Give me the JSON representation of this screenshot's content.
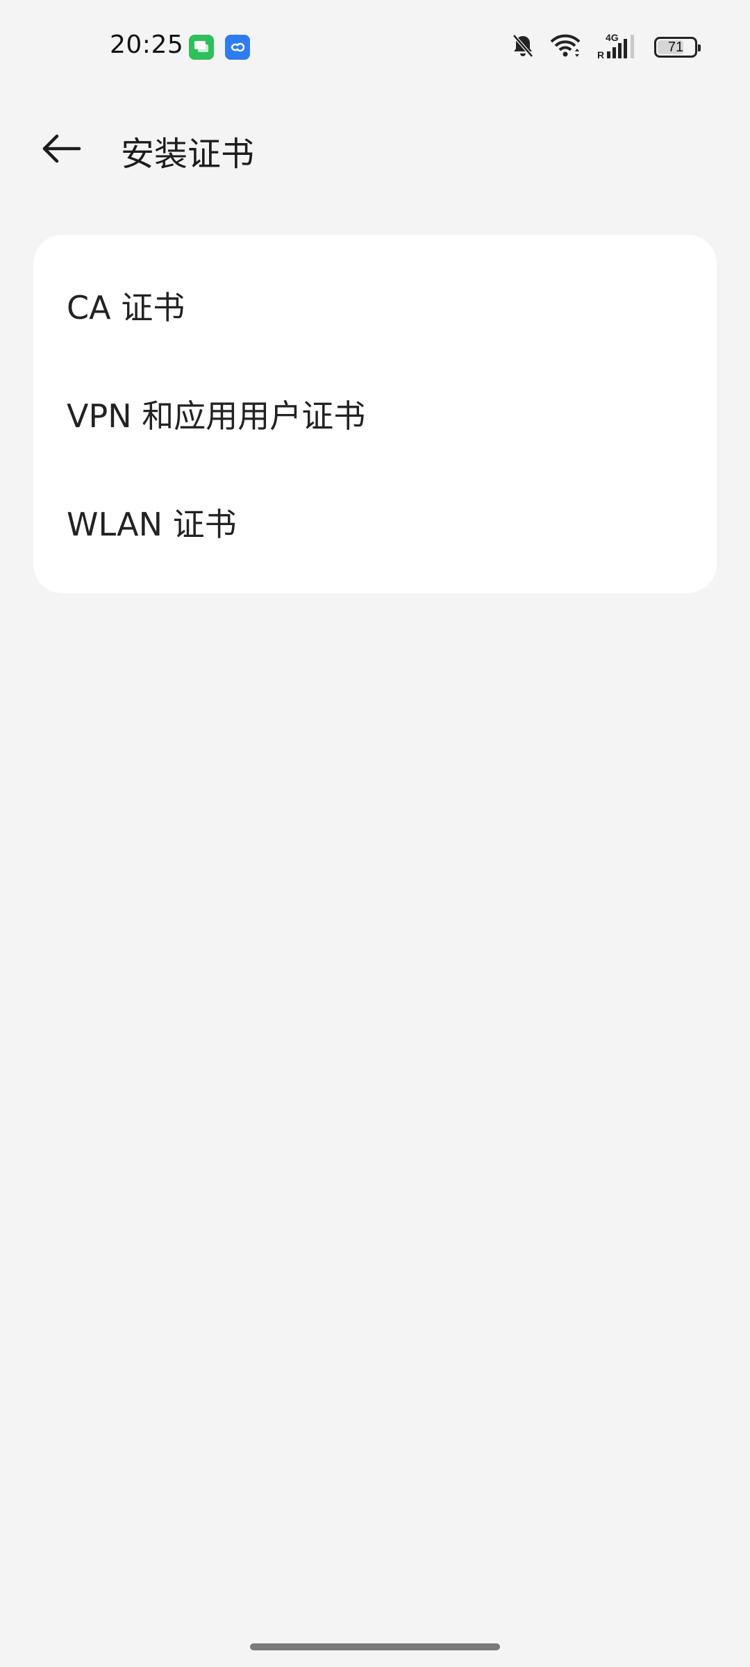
{
  "status_bar": {
    "time": "20:25",
    "notifications": [
      "messages-app-icon",
      "cloud-app-icon"
    ],
    "icons": [
      "bell-muted-icon",
      "wifi-icon",
      "cellular-4g-icon"
    ],
    "network_type": "4G",
    "roaming_indicator": "R",
    "battery_level": "71",
    "battery_fraction": 0.71
  },
  "header": {
    "title": "安装证书",
    "back_icon": "arrow-left-icon"
  },
  "list": {
    "items": [
      {
        "label": "CA 证书"
      },
      {
        "label": "VPN 和应用用户证书"
      },
      {
        "label": "WLAN 证书"
      }
    ]
  },
  "colors": {
    "background": "#f4f4f4",
    "card": "#ffffff",
    "text": "#1f1f1f",
    "messages_app": "#2fbf5b",
    "cloud_app": "#2f7cf2"
  }
}
